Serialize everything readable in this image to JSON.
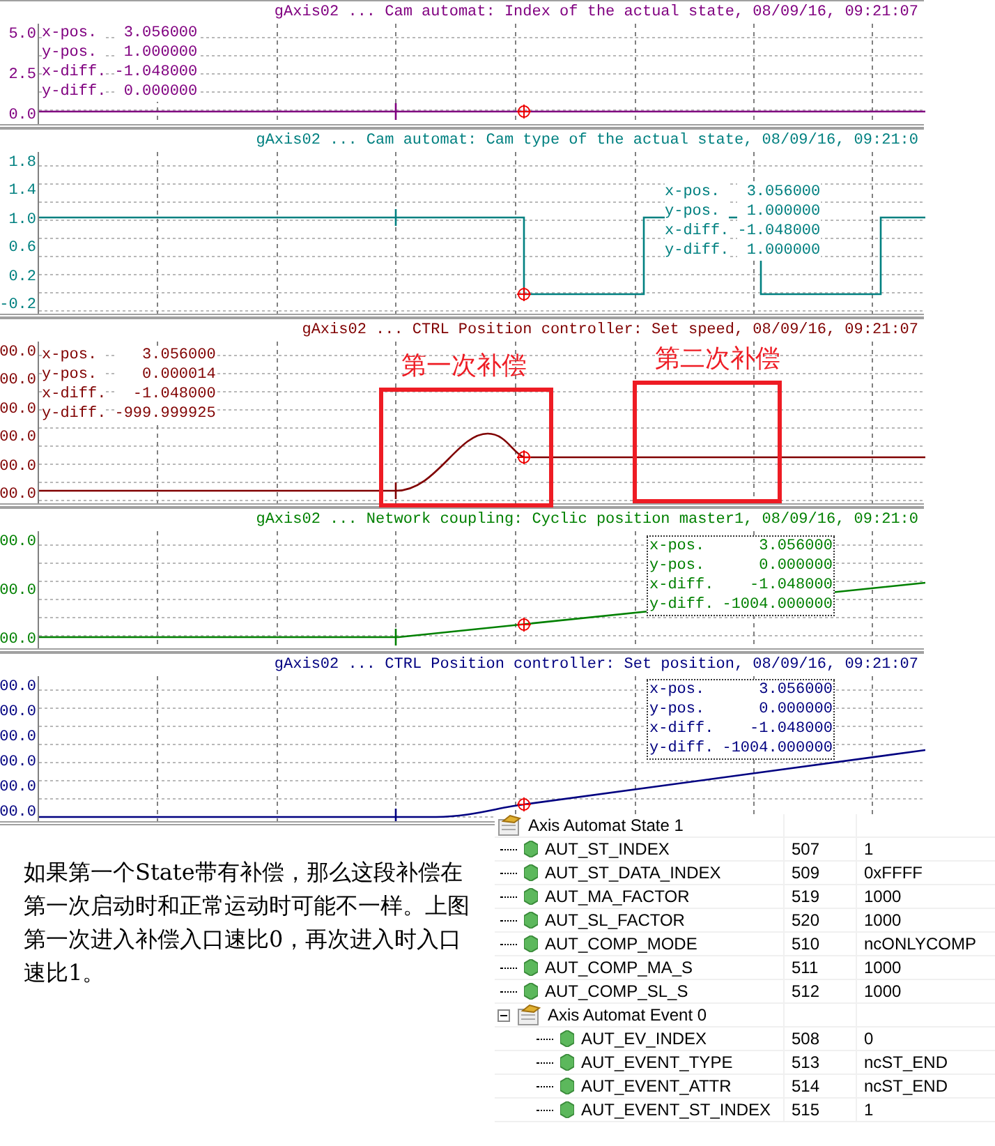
{
  "panels": [
    {
      "title": "gAxis02 ... Cam automat: Index of the actual state, 08/09/16, 09:21:07",
      "color": "#800080",
      "kind": "flat",
      "readout_framed": false,
      "y_ticks": [
        "5.0",
        "2.5",
        "0.0"
      ],
      "readout": [
        {
          "label": "x-pos.",
          "value": "3.056000"
        },
        {
          "label": "y-pos.",
          "value": "1.000000"
        },
        {
          "label": "x-diff.",
          "value": "-1.048000"
        },
        {
          "label": "y-diff.",
          "value": "0.000000"
        }
      ]
    },
    {
      "title": "gAxis02 ... Cam automat: Cam type of the actual state, 08/09/16, 09:21:0",
      "color": "#008080",
      "kind": "steps",
      "readout_framed": false,
      "y_ticks": [
        "1.8",
        "1.4",
        "1.0",
        "0.6",
        "0.2",
        "-0.2"
      ],
      "readout": [
        {
          "label": "x-pos.",
          "value": "3.056000"
        },
        {
          "label": "y-pos.",
          "value": "1.000000"
        },
        {
          "label": "x-diff.",
          "value": "-1.048000"
        },
        {
          "label": "y-diff.",
          "value": "1.000000"
        }
      ]
    },
    {
      "title": "gAxis02 ... CTRL Position controller: Set speed, 08/09/16, 09:21:07",
      "color": "#800000",
      "kind": "bump",
      "readout_framed": false,
      "y_ticks": [
        "00.0",
        "00.0",
        "00.0",
        "00.0",
        "00.0",
        "00.0"
      ],
      "readout": [
        {
          "label": "x-pos.",
          "value": "3.056000"
        },
        {
          "label": "y-pos.",
          "value": "0.000014"
        },
        {
          "label": "x-diff.",
          "value": "-1.048000"
        },
        {
          "label": "y-diff.",
          "value": "-999.999925"
        }
      ],
      "annotations": [
        {
          "label": "第一次补偿"
        },
        {
          "label": "第二次补偿"
        }
      ]
    },
    {
      "title": "gAxis02 ... Network coupling: Cyclic position master1, 08/09/16, 09:21:0",
      "color": "#008000",
      "kind": "ramp",
      "readout_framed": true,
      "y_ticks": [
        "00.0",
        "00.0",
        "00.0"
      ],
      "readout": [
        {
          "label": "x-pos.",
          "value": "3.056000"
        },
        {
          "label": "y-pos.",
          "value": "0.000000"
        },
        {
          "label": "x-diff.",
          "value": "-1.048000"
        },
        {
          "label": "y-diff.",
          "value": "-1004.000000"
        }
      ]
    },
    {
      "title": "gAxis02 ... CTRL Position controller: Set position, 08/09/16, 09:21:07",
      "color": "#000080",
      "kind": "curve_ramp",
      "readout_framed": true,
      "y_ticks": [
        "00.0",
        "00.0",
        "00.0",
        "00.0",
        "00.0",
        "00.0"
      ],
      "readout": [
        {
          "label": "x-pos.",
          "value": "3.056000"
        },
        {
          "label": "y-pos.",
          "value": "0.000000"
        },
        {
          "label": "x-diff.",
          "value": "-1.048000"
        },
        {
          "label": "y-diff.",
          "value": "-1004.000000"
        }
      ]
    }
  ],
  "note": "如果第一个State带有补偿，那么这段补偿在第一次启动时和正常运动时可能不一样。上图第一次进入补偿入口速比0，再次进入时入口速比1。",
  "tree": {
    "label": "Axis Automat State 1",
    "children": [
      {
        "kind": "param",
        "label": "AUT_ST_INDEX",
        "number": "507",
        "value": "1"
      },
      {
        "kind": "param",
        "label": "AUT_ST_DATA_INDEX",
        "number": "509",
        "value": "0xFFFF"
      },
      {
        "kind": "param",
        "label": "AUT_MA_FACTOR",
        "number": "519",
        "value": "1000"
      },
      {
        "kind": "param",
        "label": "AUT_SL_FACTOR",
        "number": "520",
        "value": "1000"
      },
      {
        "kind": "param",
        "label": "AUT_COMP_MODE",
        "number": "510",
        "value": "ncONLYCOMP"
      },
      {
        "kind": "param",
        "label": "AUT_COMP_MA_S",
        "number": "511",
        "value": "1000"
      },
      {
        "kind": "param",
        "label": "AUT_COMP_SL_S",
        "number": "512",
        "value": "1000"
      },
      {
        "kind": "group",
        "label": "Axis Automat Event 0",
        "expanded": true,
        "children": [
          {
            "kind": "param",
            "label": "AUT_EV_INDEX",
            "number": "508",
            "value": "0"
          },
          {
            "kind": "param",
            "label": "AUT_EVENT_TYPE",
            "number": "513",
            "value": "ncST_END"
          },
          {
            "kind": "param",
            "label": "AUT_EVENT_ATTR",
            "number": "514",
            "value": "ncST_END"
          },
          {
            "kind": "param",
            "label": "AUT_EVENT_ST_INDEX",
            "number": "515",
            "value": "1"
          }
        ]
      }
    ]
  }
}
